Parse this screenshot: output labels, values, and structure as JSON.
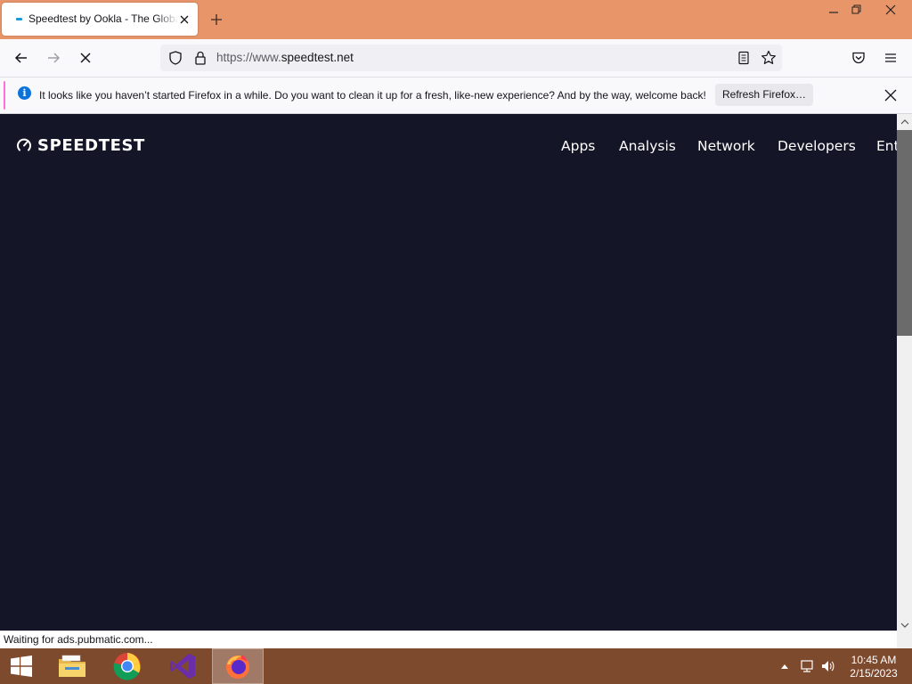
{
  "browser": {
    "tab_title": "Speedtest by Ookla - The Global Broadband Speed Test",
    "url_prefix": "https://www.",
    "url_host": "speedtest.net"
  },
  "notification": {
    "message": "It looks like you haven’t started Firefox in a while. Do you want to clean it up for a fresh, like-new experience? And by the way, welcome back!",
    "button_label": "Refresh Firefox…"
  },
  "site": {
    "logo_text": "SPEEDTEST",
    "nav": [
      "Apps",
      "Analysis",
      "Network",
      "Developers",
      "Ent"
    ]
  },
  "status_text": "Waiting for ads.pubmatic.com...",
  "taskbar": {
    "time": "10:45 AM",
    "date": "2/15/2023",
    "apps": [
      "start",
      "file-explorer",
      "chrome",
      "visual-studio",
      "firefox"
    ]
  },
  "colors": {
    "titlebar": "#e8956a",
    "page_bg": "#141526",
    "taskbar": "#7e4a2e",
    "accent": "#0b72db"
  }
}
